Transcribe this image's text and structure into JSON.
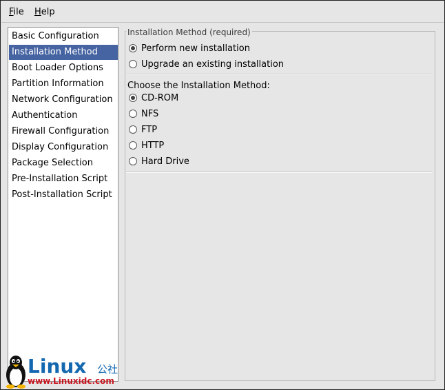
{
  "menubar": {
    "file": {
      "mnemonic": "F",
      "rest": "ile"
    },
    "help": {
      "mnemonic": "H",
      "rest": "elp"
    }
  },
  "sidebar": {
    "items": [
      {
        "label": "Basic Configuration",
        "selected": false
      },
      {
        "label": "Installation Method",
        "selected": true
      },
      {
        "label": "Boot Loader Options",
        "selected": false
      },
      {
        "label": "Partition Information",
        "selected": false
      },
      {
        "label": "Network Configuration",
        "selected": false
      },
      {
        "label": "Authentication",
        "selected": false
      },
      {
        "label": "Firewall Configuration",
        "selected": false
      },
      {
        "label": "Display Configuration",
        "selected": false
      },
      {
        "label": "Package Selection",
        "selected": false
      },
      {
        "label": "Pre-Installation Script",
        "selected": false
      },
      {
        "label": "Post-Installation Script",
        "selected": false
      }
    ]
  },
  "main": {
    "group_title": "Installation Method (required)",
    "install_type": [
      {
        "label": "Perform new installation",
        "checked": true
      },
      {
        "label": "Upgrade an existing installation",
        "checked": false
      }
    ],
    "method_heading": "Choose the Installation Method:",
    "methods": [
      {
        "label": "CD-ROM",
        "checked": true
      },
      {
        "label": "NFS",
        "checked": false
      },
      {
        "label": "FTP",
        "checked": false
      },
      {
        "label": "HTTP",
        "checked": false
      },
      {
        "label": "Hard Drive",
        "checked": false
      }
    ]
  },
  "watermark": {
    "word": "Linux",
    "cn": "公社",
    "url": "www.Linuxidc.com"
  },
  "colors": {
    "selection": "#4664a2",
    "watermark_blue": "#1468b0",
    "watermark_red": "#c8141e"
  }
}
